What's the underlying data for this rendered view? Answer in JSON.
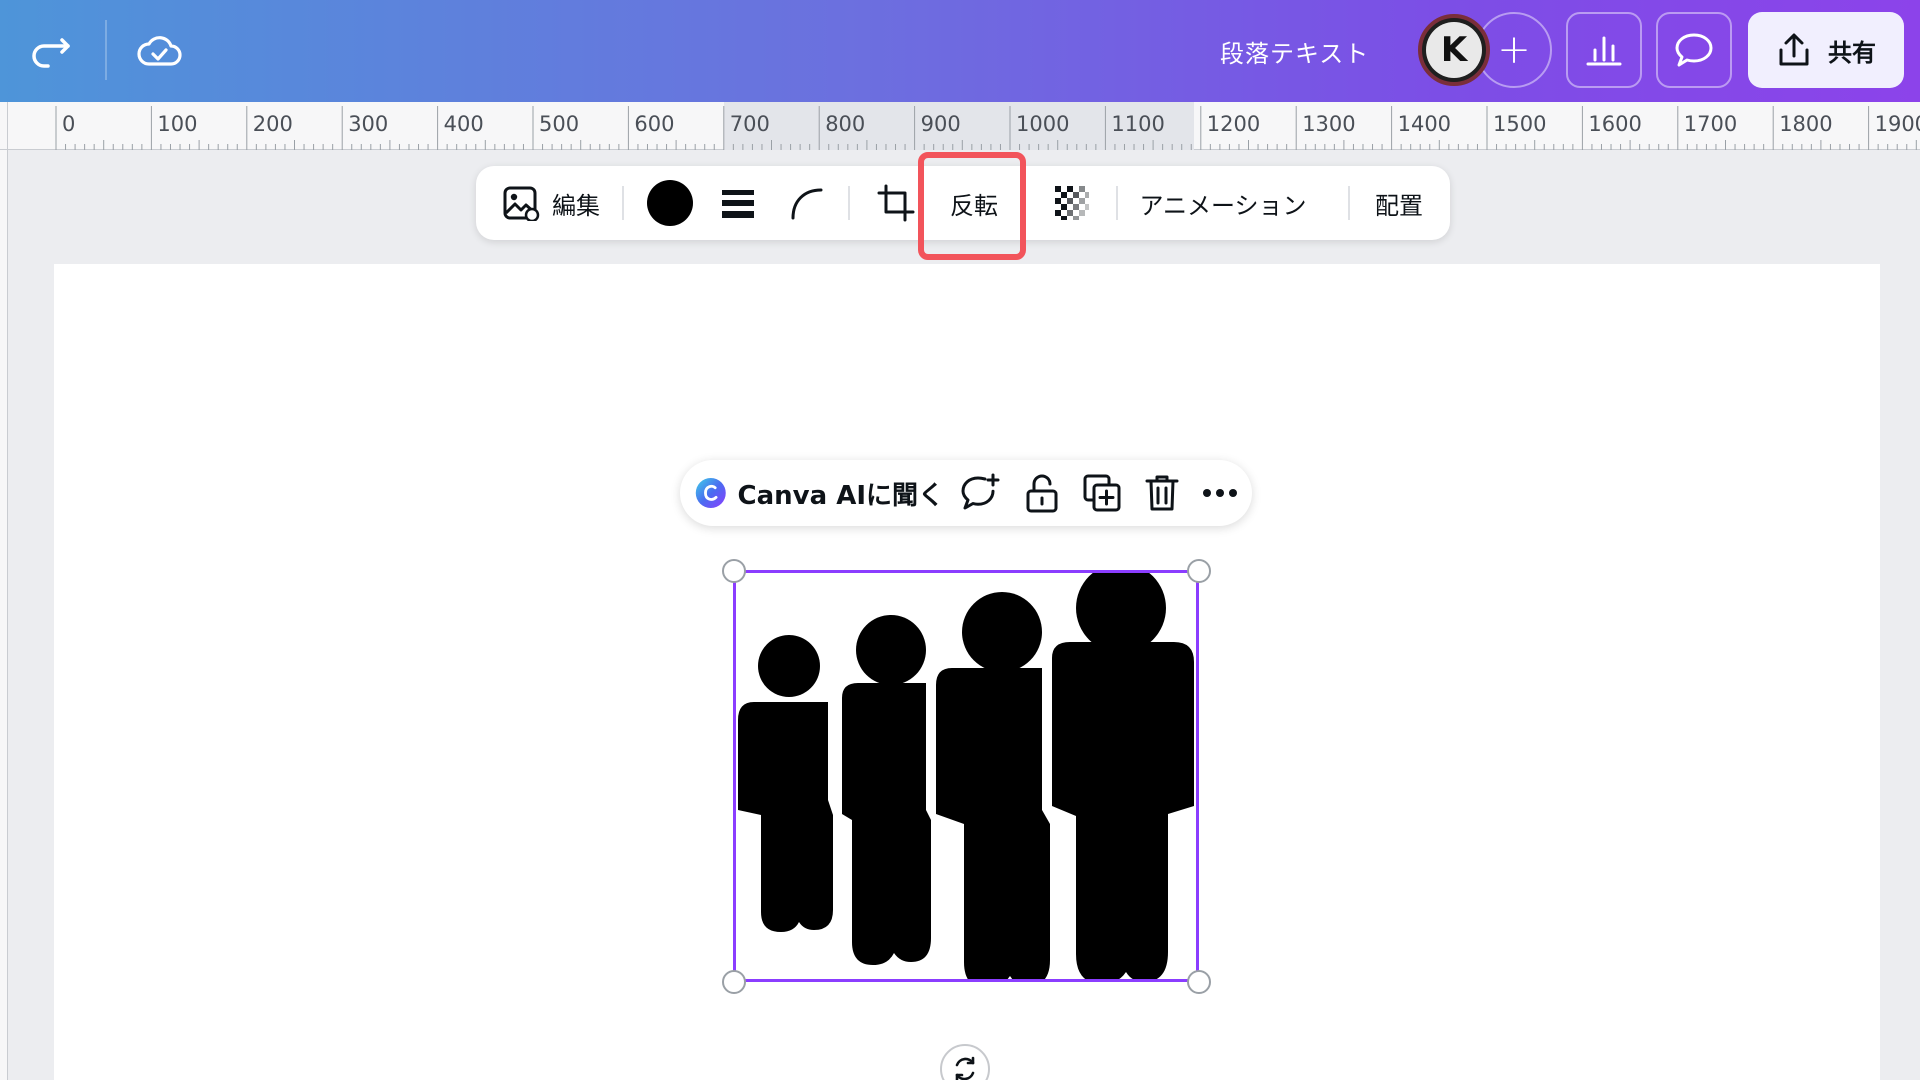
{
  "header": {
    "doc_title": "段落テキスト",
    "avatar_initial": "K",
    "share_label": "共有"
  },
  "ruler": {
    "labels": [
      "0",
      "100",
      "200",
      "300",
      "400",
      "500",
      "600",
      "700",
      "800",
      "900",
      "1000",
      "1100",
      "1200",
      "1300",
      "1400",
      "1500",
      "1600",
      "1700",
      "1800",
      "1900"
    ]
  },
  "toolbar": {
    "edit_label": "編集",
    "flip_label": "反転",
    "animation_label": "アニメーション",
    "position_label": "配置",
    "color": "#000000"
  },
  "context_menu": {
    "ai_label": "Canva AIに聞く"
  },
  "colors": {
    "header_gradient_start": "#4e95d9",
    "header_gradient_end": "#8c43ea",
    "selection": "#8b3dff",
    "highlight": "#f2545b"
  }
}
